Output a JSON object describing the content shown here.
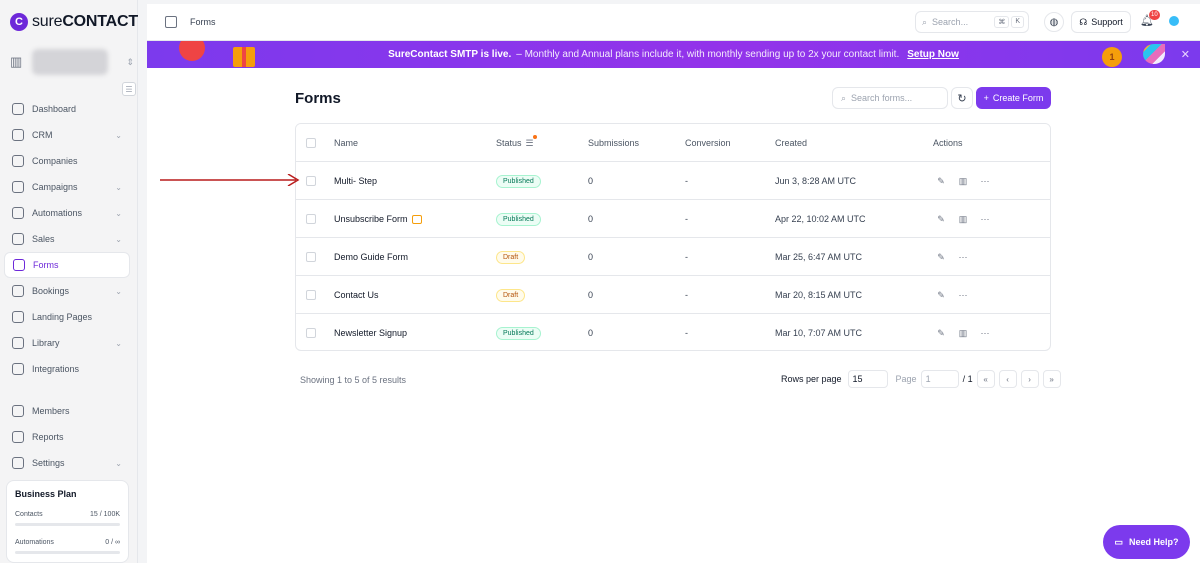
{
  "app": {
    "logo_mark": "C",
    "logo_sure": "sure",
    "logo_contact": "CONTACT"
  },
  "sidebar": {
    "items": [
      {
        "label": "Dashboard",
        "icon": "dashboard-icon",
        "chevron": false
      },
      {
        "label": "CRM",
        "icon": "crm-icon",
        "chevron": true
      },
      {
        "label": "Companies",
        "icon": "companies-icon",
        "chevron": false
      },
      {
        "label": "Campaigns",
        "icon": "campaigns-icon",
        "chevron": true
      },
      {
        "label": "Automations",
        "icon": "automations-icon",
        "chevron": true
      },
      {
        "label": "Sales",
        "icon": "sales-icon",
        "chevron": true
      },
      {
        "label": "Forms",
        "icon": "forms-icon",
        "chevron": false,
        "active": true
      },
      {
        "label": "Bookings",
        "icon": "bookings-icon",
        "chevron": true
      },
      {
        "label": "Landing Pages",
        "icon": "landing-pages-icon",
        "chevron": false
      },
      {
        "label": "Library",
        "icon": "library-icon",
        "chevron": true
      },
      {
        "label": "Integrations",
        "icon": "integrations-icon",
        "chevron": false
      },
      {
        "label": "Members",
        "icon": "members-icon",
        "chevron": false
      },
      {
        "label": "Reports",
        "icon": "reports-icon",
        "chevron": false
      },
      {
        "label": "Settings",
        "icon": "settings-icon",
        "chevron": true
      }
    ],
    "plan": {
      "title": "Business Plan",
      "contacts_label": "Contacts",
      "contacts_value": "15 / 100K",
      "contacts_fraction": 0.00015,
      "automations_label": "Automations",
      "automations_value": "0 / ∞"
    }
  },
  "topbar": {
    "breadcrumb": "Forms",
    "search_placeholder": "Search...",
    "kbd_cmd": "⌘",
    "kbd_k": "K",
    "support_label": "Support",
    "notification_count": "10"
  },
  "banner": {
    "headline": "SureContact SMTP is live.",
    "message": "– Monthly and Annual plans include it, with monthly sending up to 2x your contact limit.",
    "cta": "Setup Now",
    "medal_number": "1"
  },
  "main": {
    "title": "Forms",
    "search_placeholder": "Search forms...",
    "create_label": "Create Form",
    "columns": [
      "Name",
      "Status",
      "Submissions",
      "Conversion",
      "Created",
      "Actions"
    ],
    "rows": [
      {
        "name": "Multi- Step",
        "status": "Published",
        "status_kind": "published",
        "submissions": "0",
        "conversion": "-",
        "created": "Jun 3, 8:28 AM UTC",
        "has_link_icon": false,
        "has_stats": true
      },
      {
        "name": "Unsubscribe Form",
        "status": "Published",
        "status_kind": "published",
        "submissions": "0",
        "conversion": "-",
        "created": "Apr 22, 10:02 AM UTC",
        "has_link_icon": true,
        "has_stats": true
      },
      {
        "name": "Demo Guide Form",
        "status": "Draft",
        "status_kind": "draft",
        "submissions": "0",
        "conversion": "-",
        "created": "Mar 25, 6:47 AM UTC",
        "has_link_icon": false,
        "has_stats": false
      },
      {
        "name": "Contact Us",
        "status": "Draft",
        "status_kind": "draft",
        "submissions": "0",
        "conversion": "-",
        "created": "Mar 20, 8:15 AM UTC",
        "has_link_icon": false,
        "has_stats": false
      },
      {
        "name": "Newsletter Signup",
        "status": "Published",
        "status_kind": "published",
        "submissions": "0",
        "conversion": "-",
        "created": "Mar 10, 7:07 AM UTC",
        "has_link_icon": false,
        "has_stats": true
      }
    ],
    "showing_text": "Showing 1 to 5 of 5 results",
    "rows_per_page_label": "Rows per page",
    "rows_per_page_value": "15",
    "page_label": "Page",
    "page_value": "1",
    "page_total": "/ 1"
  },
  "help": {
    "label": "Need Help?"
  },
  "colors": {
    "accent": "#7c3aed",
    "annotation_arrow": "#b91c1c"
  }
}
